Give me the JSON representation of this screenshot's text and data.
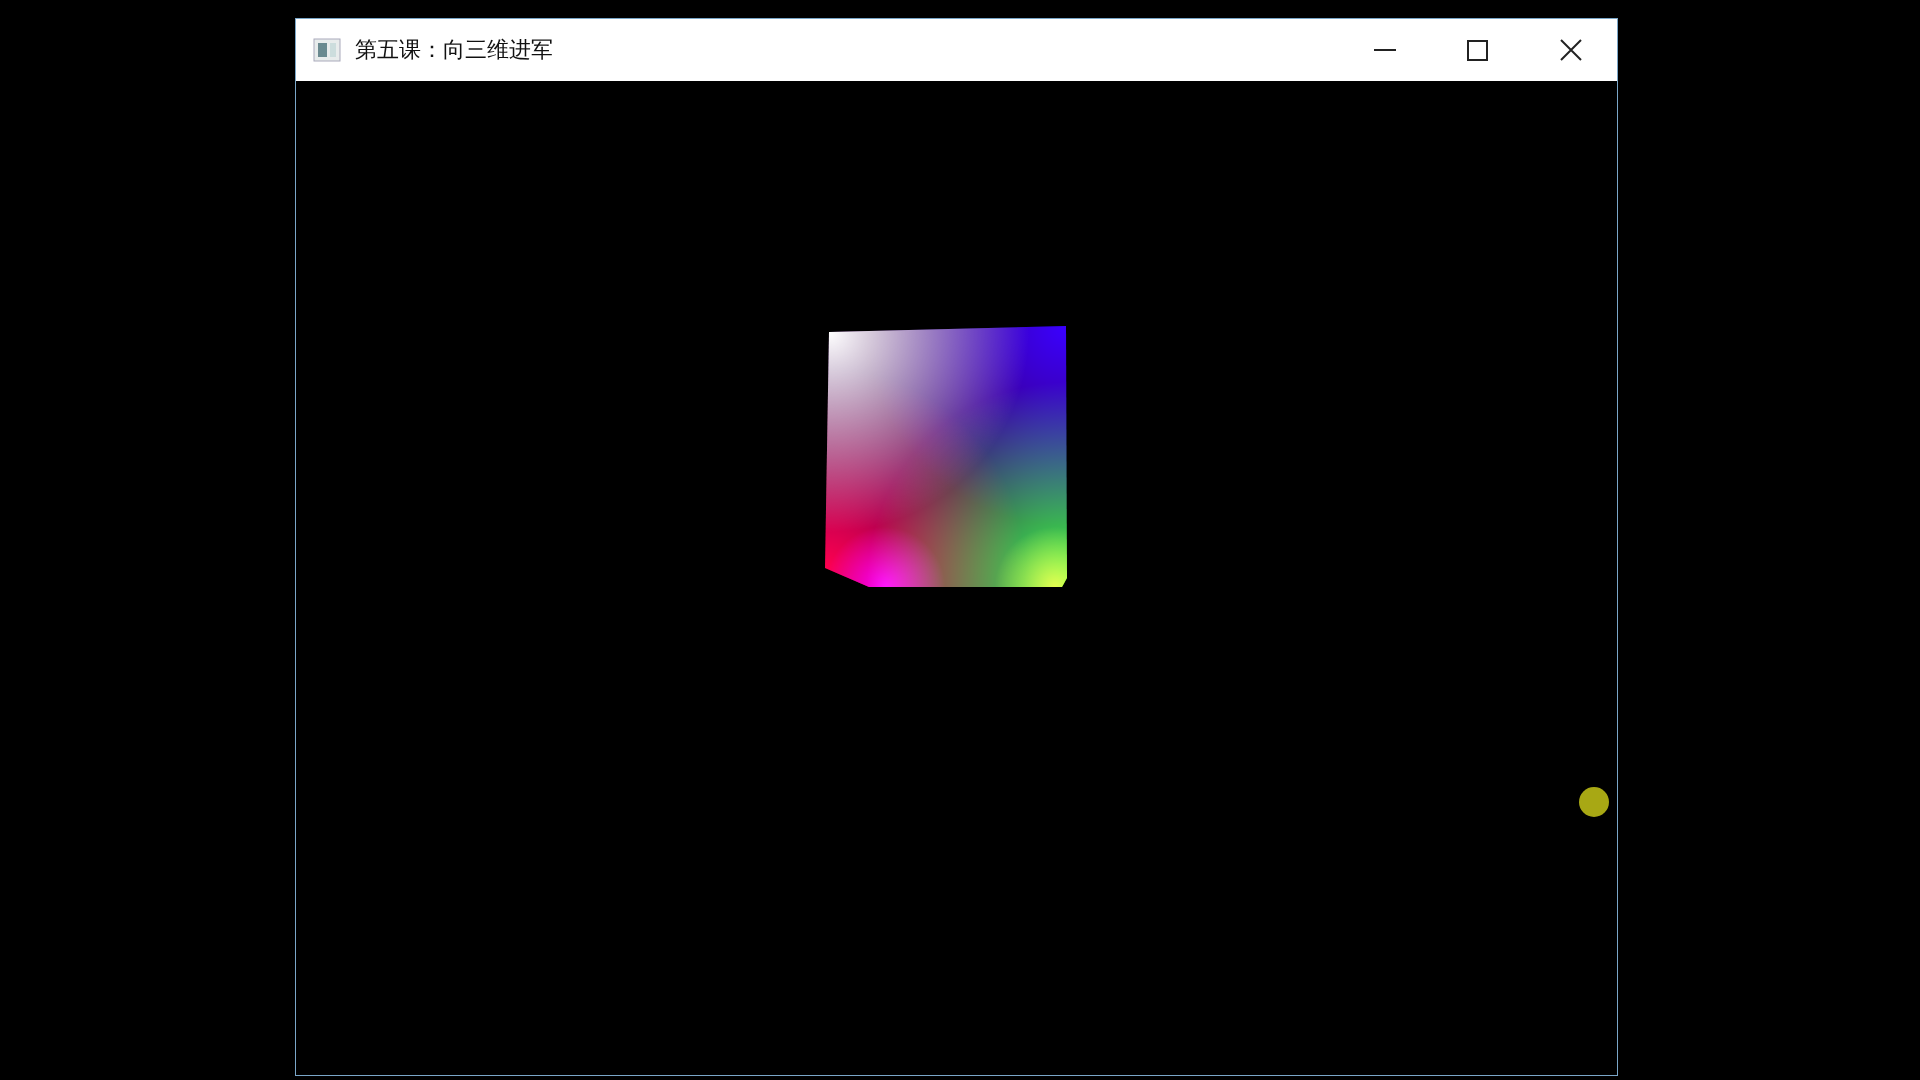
{
  "window": {
    "title": "第五课：向三维进军"
  }
}
